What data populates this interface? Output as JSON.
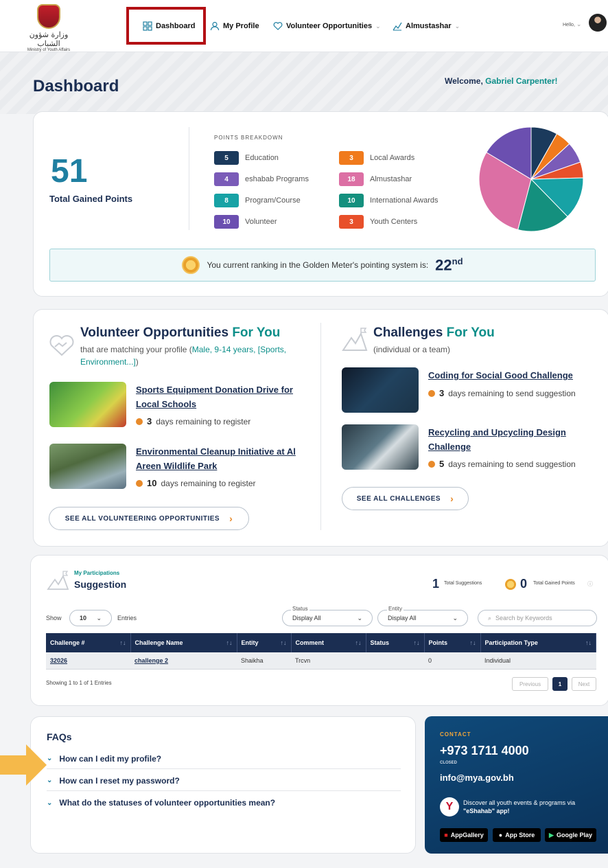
{
  "header": {
    "logo_ar": "وزارة شؤون الشباب",
    "logo_en": "Ministry of Youth Affairs",
    "nav": [
      {
        "label": "Dashboard",
        "icon": "grid-icon"
      },
      {
        "label": "My Profile",
        "icon": "user-icon"
      },
      {
        "label": "Volunteer Opportunities",
        "icon": "heart-hand-icon"
      },
      {
        "label": "Almustashar",
        "icon": "chart-icon"
      }
    ],
    "hello": "Hello,"
  },
  "page": {
    "title": "Dashboard",
    "welcome_prefix": "Welcome,",
    "welcome_name": "Gabriel Carpenter!"
  },
  "points": {
    "total": "51",
    "total_label": "Total Gained Points",
    "breakdown_title": "POINTS BREAKDOWN",
    "items": [
      {
        "value": 5,
        "label": "Education",
        "color": "#1b3a5c"
      },
      {
        "value": 4,
        "label": "eshabab Programs",
        "color": "#7a5bb8"
      },
      {
        "value": 8,
        "label": "Program/Course",
        "color": "#17a2a5"
      },
      {
        "value": 10,
        "label": "Volunteer",
        "color": "#6b4fb0"
      },
      {
        "value": 3,
        "label": "Local Awards",
        "color": "#f07a1c"
      },
      {
        "value": 18,
        "label": "Almustashar",
        "color": "#dc6fa4"
      },
      {
        "value": 10,
        "label": "International Awards",
        "color": "#14907e"
      },
      {
        "value": 3,
        "label": "Youth Centers",
        "color": "#e8502a"
      }
    ],
    "ranking_text": "You current ranking in the Golden Meter's pointing system is:",
    "ranking_value": "22",
    "ranking_suffix": "nd"
  },
  "volunteer": {
    "title": "Volunteer Opportunities",
    "title_accent": "For You",
    "sub_prefix": "that are matching your profile (",
    "sub_match": "Male, 9-14 years, [Sports, Environment...]",
    "sub_suffix": ")",
    "items": [
      {
        "title_line1": "Sports Equipment Donation Drive for",
        "title_line2": "Local Schools",
        "days": "3",
        "remain_text": "days remaining to register"
      },
      {
        "title_line1": "Environmental Cleanup Initiative at Al",
        "title_line2": "Areen Wildlife Park",
        "days": "10",
        "remain_text": "days remaining to register"
      }
    ],
    "see_all": "SEE ALL VOLUNTEERING OPPORTUNITIES"
  },
  "challenges": {
    "title": "Challenges",
    "title_accent": "For You",
    "sub": "(individual or a team)",
    "items": [
      {
        "title_line1": "Coding for Social Good Challenge",
        "title_line2": "",
        "days": "3",
        "remain_text": "days remaining to send suggestion"
      },
      {
        "title_line1": "Recycling and Upcycling Design",
        "title_line2": "Challenge",
        "days": "5",
        "remain_text": "days remaining to send suggestion"
      }
    ],
    "see_all": "SEE ALL CHALLENGES"
  },
  "participations": {
    "label": "My Participations",
    "title": "Suggestion",
    "total_suggestions": "1",
    "total_suggestions_label": "Total Suggestions",
    "total_points": "0",
    "total_points_label": "Total Gained Points",
    "show": "Show",
    "entries_value": "10",
    "entries": "Entries",
    "status_label": "Status",
    "status_value": "Display All",
    "entity_label": "Entity",
    "entity_value": "Display All",
    "search_placeholder": "Search by Keywords",
    "columns": [
      "Challenge #",
      "Challenge Name",
      "Entity",
      "Comment",
      "Status",
      "Points",
      "Participation Type"
    ],
    "rows": [
      {
        "num": "32026",
        "name": "challenge 2",
        "entity": "Shaikha",
        "comment": "Trcvn",
        "status": "",
        "points": "0",
        "type": "Individual"
      }
    ],
    "showing": "Showing 1 to 1 of 1 Entries",
    "prev": "Previous",
    "page": "1",
    "next": "Next"
  },
  "faqs": {
    "title": "FAQs",
    "items": [
      "How can I edit my profile?",
      "How can I reset my password?",
      "What do the statuses of volunteer opportunities mean?"
    ]
  },
  "contact": {
    "label": "CONTACT",
    "phone": "+973 1711 4000",
    "status": "CLOSED",
    "email": "info@mya.gov.bh",
    "app_text": "Discover all youth events & programs via",
    "app_name": "\"eShahab\" app!",
    "stores": [
      "AppGallery",
      "App Store",
      "Google Play"
    ]
  }
}
